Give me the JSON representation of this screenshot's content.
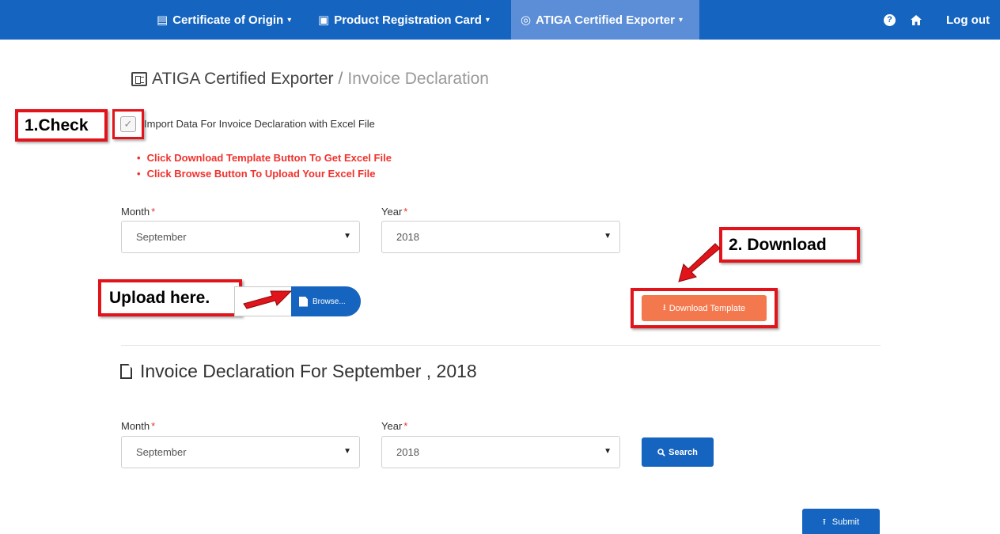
{
  "navbar": {
    "items": [
      {
        "label": "Certificate of Origin",
        "icon": "certificate-icon"
      },
      {
        "label": "Product Registration Card",
        "icon": "id-card-icon"
      },
      {
        "label": "ATIGA Certified Exporter",
        "icon": "badge-icon",
        "active": true
      }
    ],
    "logout_label": "Log out",
    "help_glyph": "?",
    "caret": "▾"
  },
  "page": {
    "title": "ATIGA Certified Exporter",
    "separator": "/",
    "subtitle": "Invoice Declaration"
  },
  "import_section": {
    "checkbox_label": "Import Data For Invoice Declaration with Excel File",
    "checked": true,
    "hints": [
      "Click Download Template Button To Get Excel File",
      "Click Browse Button To Upload Your Excel File"
    ],
    "month_label": "Month",
    "year_label": "Year",
    "required_mark": "*",
    "month_value": "September",
    "year_value": "2018",
    "browse_label": "Browse...",
    "download_label": "Download Template"
  },
  "annotations": {
    "check": "1.Check",
    "download": "2. Download",
    "upload": "Upload here.",
    "color": "#e0141a"
  },
  "list_section": {
    "title": "Invoice Declaration For September , 2018",
    "month_label": "Month",
    "year_label": "Year",
    "month_value": "September",
    "year_value": "2018",
    "search_label": "Search",
    "submit_label": "Submit"
  },
  "colors": {
    "primary": "#1565c0",
    "download": "#f4784e",
    "hint": "#f0322d"
  }
}
